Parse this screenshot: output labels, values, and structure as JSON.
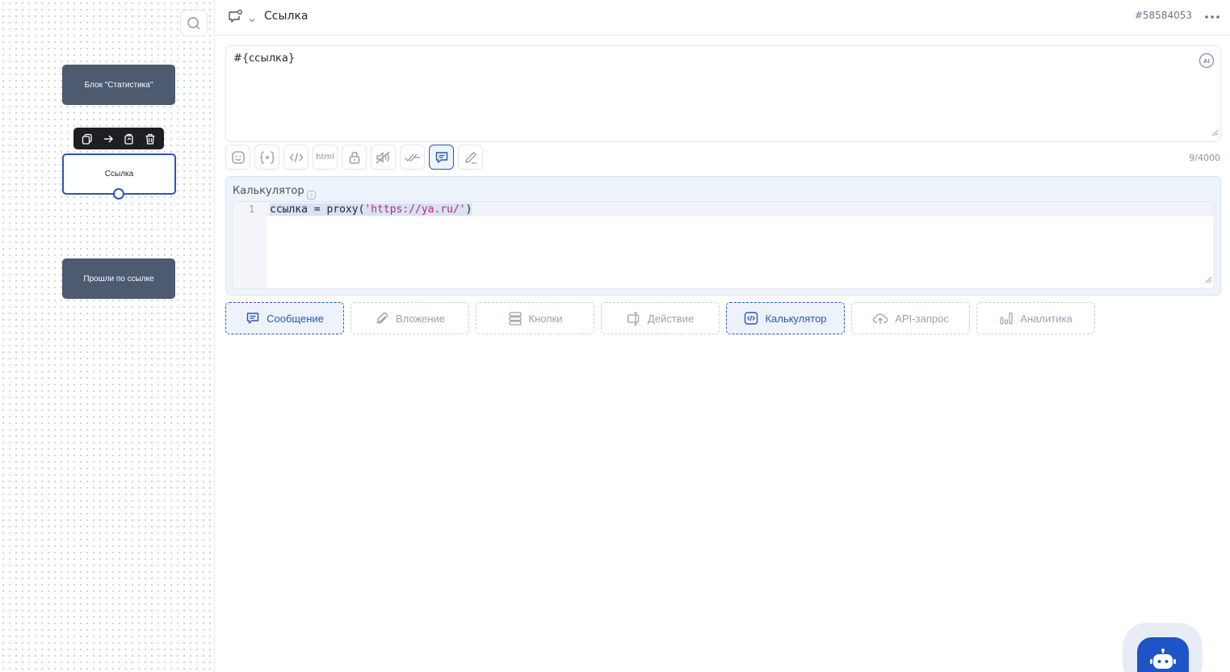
{
  "canvas": {
    "nodes": [
      {
        "label": "Блок \"Статистика\""
      },
      {
        "label": "Ссылка"
      },
      {
        "label": "Прошли по ссылке"
      }
    ]
  },
  "header": {
    "title": "Ссылка",
    "block_id": "#58584053"
  },
  "message": {
    "text": "#{ссылка}",
    "counter": "9/4000"
  },
  "format_toolbar": {
    "html_label": "html"
  },
  "calculator": {
    "label": "Калькулятор",
    "line_number": "1",
    "code_prefix": "ссылка = proxy(",
    "code_string": "'https://ya.ru/'",
    "code_suffix": ")"
  },
  "block_types": [
    {
      "label": "Сообщение",
      "icon": "message-icon",
      "active": true
    },
    {
      "label": "Вложение",
      "icon": "paperclip-icon",
      "active": false
    },
    {
      "label": "Кнопки",
      "icon": "buttons-icon",
      "active": false
    },
    {
      "label": "Действие",
      "icon": "action-icon",
      "active": false
    },
    {
      "label": "Калькулятор",
      "icon": "code-icon",
      "active": true
    },
    {
      "label": "API-запрос",
      "icon": "cloud-upload-icon",
      "active": false
    },
    {
      "label": "Аналитика",
      "icon": "analytics-icon",
      "active": false
    }
  ],
  "colors": {
    "accent": "#2a56b8",
    "node_dark": "#4d5a70",
    "fab": "#1e54c7"
  }
}
